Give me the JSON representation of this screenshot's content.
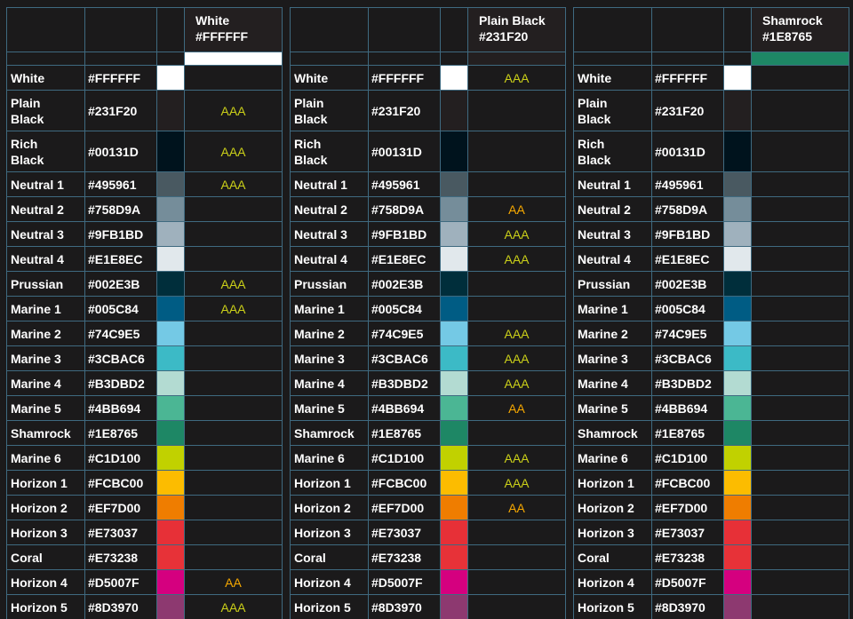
{
  "colors": [
    {
      "name": "White",
      "hex": "#FFFFFF"
    },
    {
      "name": "Plain Black",
      "hex": "#231F20"
    },
    {
      "name": "Rich Black",
      "hex": "#00131D"
    },
    {
      "name": "Neutral 1",
      "hex": "#495961"
    },
    {
      "name": "Neutral 2",
      "hex": "#758D9A"
    },
    {
      "name": "Neutral 3",
      "hex": "#9FB1BD"
    },
    {
      "name": "Neutral 4",
      "hex": "#E1E8EC"
    },
    {
      "name": "Prussian",
      "hex": "#002E3B"
    },
    {
      "name": "Marine 1",
      "hex": "#005C84"
    },
    {
      "name": "Marine 2",
      "hex": "#74C9E5"
    },
    {
      "name": "Marine 3",
      "hex": "#3CBAC6"
    },
    {
      "name": "Marine 4",
      "hex": "#B3DBD2"
    },
    {
      "name": "Marine 5",
      "hex": "#4BB694"
    },
    {
      "name": "Shamrock",
      "hex": "#1E8765"
    },
    {
      "name": "Marine 6",
      "hex": "#C1D100"
    },
    {
      "name": "Horizon 1",
      "hex": "#FCBC00"
    },
    {
      "name": "Horizon 2",
      "hex": "#EF7D00"
    },
    {
      "name": "Horizon 3",
      "hex": "#E73037"
    },
    {
      "name": "Coral",
      "hex": "#E73238"
    },
    {
      "name": "Horizon 4",
      "hex": "#D5007F"
    },
    {
      "name": "Horizon 5",
      "hex": "#8D3970"
    }
  ],
  "panels": [
    {
      "title_name": "White",
      "title_hex": "#FFFFFF",
      "ratings": [
        "",
        "AAA",
        "AAA",
        "AAA",
        "",
        "",
        "",
        "AAA",
        "AAA",
        "",
        "",
        "",
        "",
        "",
        "",
        "",
        "",
        "",
        "",
        "AA",
        "AAA"
      ]
    },
    {
      "title_name": "Plain Black",
      "title_hex": "#231F20",
      "ratings": [
        "AAA",
        "",
        "",
        "",
        "AA",
        "AAA",
        "AAA",
        "",
        "",
        "AAA",
        "AAA",
        "AAA",
        "AA",
        "",
        "AAA",
        "AAA",
        "AA",
        "",
        "",
        "",
        ""
      ]
    },
    {
      "title_name": "Shamrock",
      "title_hex": "#1E8765",
      "ratings": [
        "",
        "",
        "",
        "",
        "",
        "",
        "",
        "",
        "",
        "",
        "",
        "",
        "",
        "",
        "",
        "",
        "",
        "",
        "",
        "",
        ""
      ]
    }
  ],
  "rating_colors": {
    "AAA": "#cbd019",
    "AA": "#f6a800"
  }
}
